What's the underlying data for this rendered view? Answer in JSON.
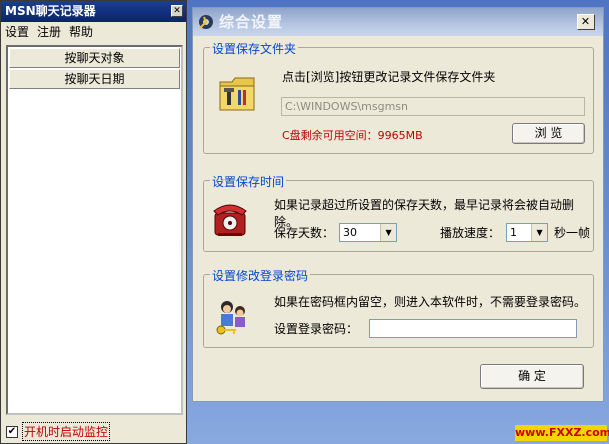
{
  "left_window": {
    "title": "MSN聊天记录器",
    "close_glyph": "✕",
    "menu": [
      "设置",
      "注册",
      "帮助"
    ],
    "buttons": [
      "按聊天对象",
      "按聊天日期"
    ],
    "autostart": {
      "checked": true,
      "check_glyph": "✔",
      "label": "开机时启动监控"
    }
  },
  "main_window": {
    "title": "综合设置",
    "close_glyph": "✕",
    "save_folder": {
      "title": "设置保存文件夹",
      "description": "点击[浏览]按钮更改记录文件保存文件夹",
      "path": "C:\\WINDOWS\\msgmsn",
      "disk_space": "C盘剩余可用空间：9965MB",
      "browse_label": "浏 览",
      "icon": "folder-tools-icon"
    },
    "save_time": {
      "title": "设置保存时间",
      "description": "如果记录超过所设置的保存天数，最早记录将会被自动删除。",
      "days_label": "保存天数：",
      "days_value": "30",
      "speed_label": "播放速度：",
      "speed_value": "1",
      "speed_unit": "秒一帧",
      "icon": "telephone-icon"
    },
    "password": {
      "title": "设置修改登录密码",
      "description": "如果在密码框内留空，则进入本软件时，不需要登录密码。",
      "password_label": "设置登录密码：",
      "password_value": "",
      "icon": "people-keys-icon"
    },
    "ok_label": "确 定"
  },
  "watermark": "www.FXXZ.com",
  "colors": {
    "group_title": "#0046d5",
    "warning_red": "#c00000",
    "titlebar_dark": "#0a246a",
    "window_bg": "#ece9d8"
  }
}
